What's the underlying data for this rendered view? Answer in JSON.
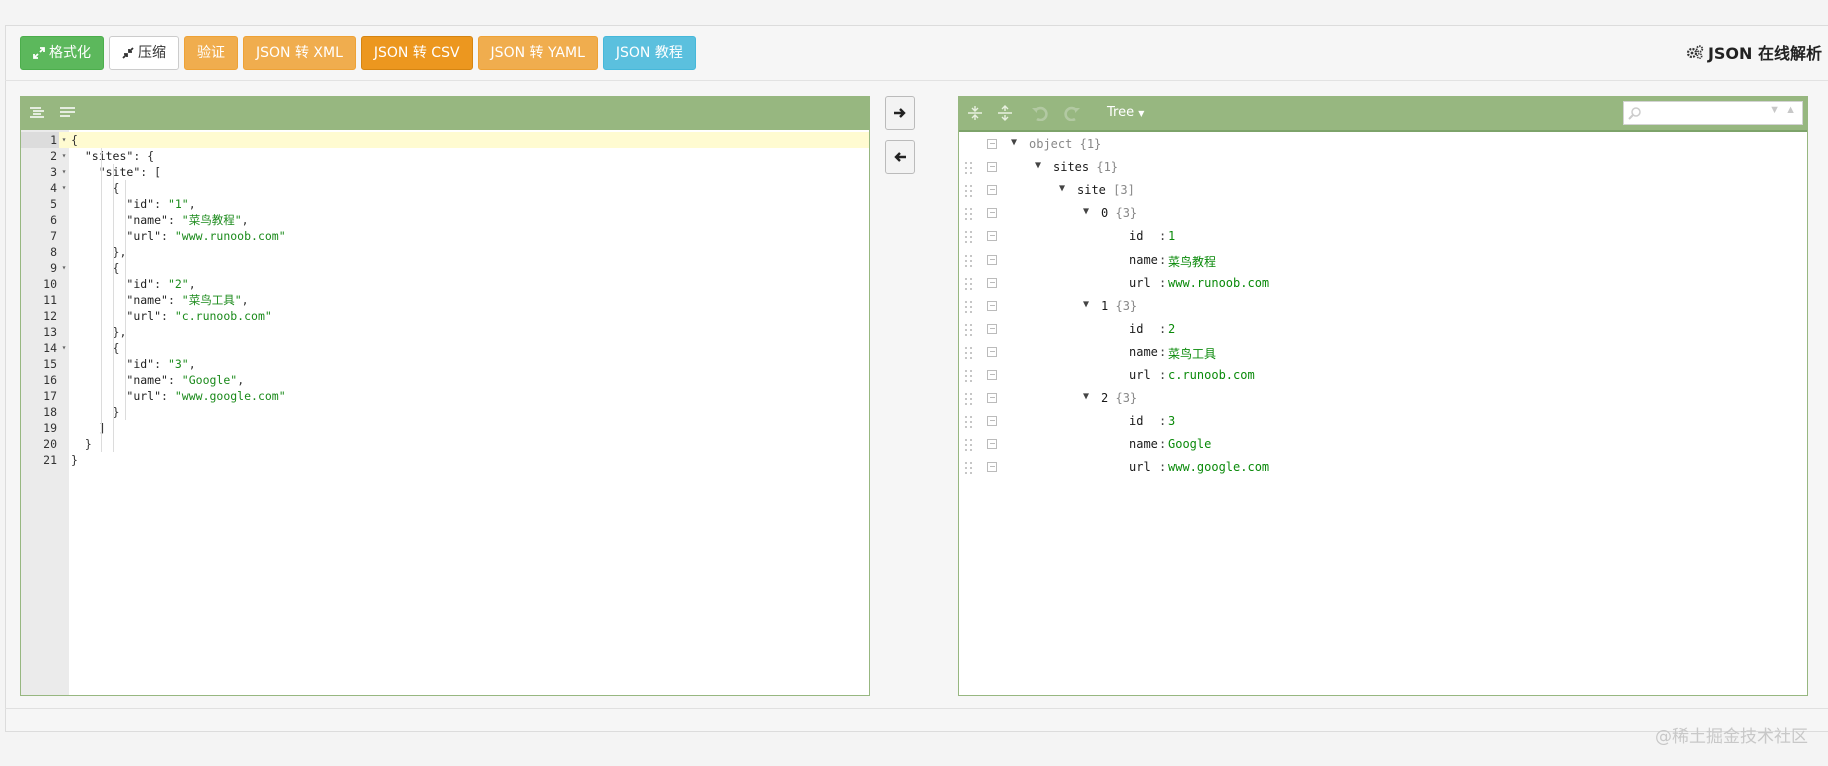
{
  "toolbar": {
    "format_label": "格式化",
    "compress_label": "压缩",
    "validate_label": "验证",
    "to_xml_label": "JSON 转 XML",
    "to_csv_label": "JSON 转 CSV",
    "to_yaml_label": "JSON 转 YAML",
    "tutorial_label": "JSON 教程"
  },
  "page_title": "JSON 在线解析",
  "colors": {
    "green": "#5cb85c",
    "orange": "#f0ad4e",
    "orange_active": "#ec971f",
    "blue": "#5bc0de",
    "editor_header": "#97b780"
  },
  "editor": {
    "lines": [
      {
        "n": "1",
        "text": "{"
      },
      {
        "n": "2",
        "text": "  \"sites\": {"
      },
      {
        "n": "3",
        "text": "    \"site\": ["
      },
      {
        "n": "4",
        "text": "      {"
      },
      {
        "n": "5",
        "text": "        \"id\": \"1\","
      },
      {
        "n": "6",
        "text": "        \"name\": \"菜鸟教程\","
      },
      {
        "n": "7",
        "text": "        \"url\": \"www.runoob.com\""
      },
      {
        "n": "8",
        "text": "      },"
      },
      {
        "n": "9",
        "text": "      {"
      },
      {
        "n": "10",
        "text": "        \"id\": \"2\","
      },
      {
        "n": "11",
        "text": "        \"name\": \"菜鸟工具\","
      },
      {
        "n": "12",
        "text": "        \"url\": \"c.runoob.com\""
      },
      {
        "n": "13",
        "text": "      },"
      },
      {
        "n": "14",
        "text": "      {"
      },
      {
        "n": "15",
        "text": "        \"id\": \"3\","
      },
      {
        "n": "16",
        "text": "        \"name\": \"Google\","
      },
      {
        "n": "17",
        "text": "        \"url\": \"www.google.com\""
      },
      {
        "n": "18",
        "text": "      }"
      },
      {
        "n": "19",
        "text": "    ]"
      },
      {
        "n": "20",
        "text": "  }"
      },
      {
        "n": "21",
        "text": "}"
      }
    ],
    "foldable_lines": [
      "1",
      "2",
      "3",
      "4",
      "9",
      "14"
    ],
    "active_line": "1"
  },
  "tree": {
    "mode_label": "Tree",
    "rows": [
      {
        "field": "object",
        "meta": "{1}",
        "toggle": "▼"
      },
      {
        "field": "sites",
        "meta": "{1}",
        "toggle": "▼"
      },
      {
        "field": "site",
        "meta": "[3]",
        "toggle": "▼"
      },
      {
        "field": "0",
        "meta": "{3}",
        "toggle": "▼"
      },
      {
        "field": "id",
        "value": "1"
      },
      {
        "field": "name",
        "value": "菜鸟教程"
      },
      {
        "field": "url",
        "value": "www.runoob.com"
      },
      {
        "field": "1",
        "meta": "{3}",
        "toggle": "▼"
      },
      {
        "field": "id",
        "value": "2"
      },
      {
        "field": "name",
        "value": "菜鸟工具"
      },
      {
        "field": "url",
        "value": "c.runoob.com"
      },
      {
        "field": "2",
        "meta": "{3}",
        "toggle": "▼"
      },
      {
        "field": "id",
        "value": "3"
      },
      {
        "field": "name",
        "value": "Google"
      },
      {
        "field": "url",
        "value": "www.google.com"
      }
    ]
  },
  "watermark": "@稀土掘金技术社区"
}
